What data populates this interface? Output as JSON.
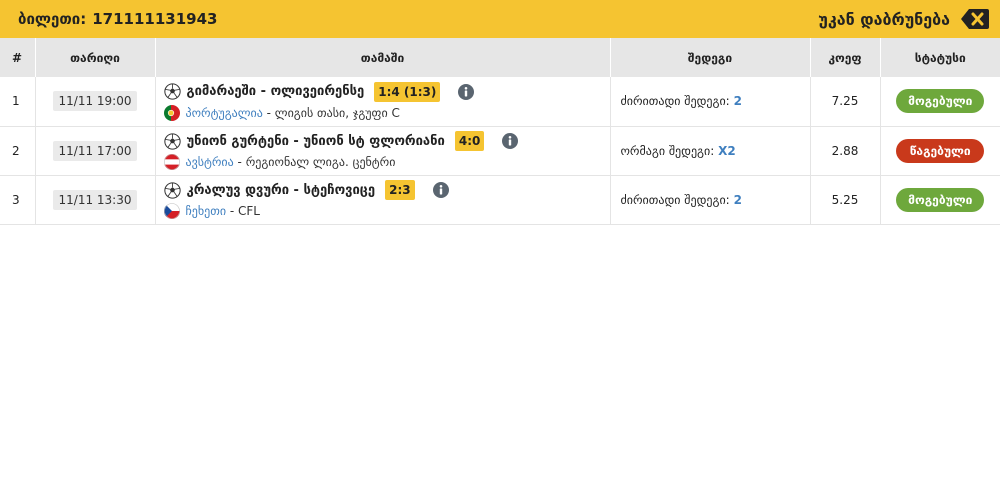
{
  "header": {
    "ticket_label": "ბილეთი:",
    "ticket_number": "171111131943",
    "back_label": "უკან დაბრუნება"
  },
  "table": {
    "columns": [
      "#",
      "თარიღი",
      "თამაში",
      "შედეგი",
      "კოეფ",
      "სტატუსი"
    ],
    "rows": [
      {
        "num": "1",
        "date": "11/11 19:00",
        "teams": "გიმარაეში - ოლივეირენსე",
        "score": "1:4 (1:3)",
        "country": "პორტუგალია",
        "league": " - ლიგის თასი, ჯგუფი C",
        "bet_label": "ძირითადი შედეგი:",
        "bet_value": "2",
        "coef": "7.25",
        "status": "მოგებული",
        "status_type": "won",
        "flag": "portugal-flag-icon"
      },
      {
        "num": "2",
        "date": "11/11 17:00",
        "teams": "უნიონ გურტენი - უნიონ სტ ფლორიანი",
        "score": "4:0",
        "country": "ავსტრია",
        "league": " - რეგიონალ ლიგა. ცენტრი",
        "bet_label": "ორმაგი შედეგი:",
        "bet_value": "X2",
        "coef": "2.88",
        "status": "წაგებული",
        "status_type": "lost",
        "flag": "austria-flag-icon"
      },
      {
        "num": "3",
        "date": "11/11 13:30",
        "teams": "კრალუვ დვური - სტეჩოვიცე",
        "score": "2:3",
        "country": "ჩეხეთი",
        "league": " - CFL",
        "bet_label": "ძირითადი შედეგი:",
        "bet_value": "2",
        "coef": "5.25",
        "status": "მოგებული",
        "status_type": "won",
        "flag": "czech-flag-icon"
      }
    ]
  },
  "colors": {
    "accent": "#f5c431",
    "won": "#6ea83c",
    "lost": "#c9391b",
    "link": "#3f7fbf"
  }
}
